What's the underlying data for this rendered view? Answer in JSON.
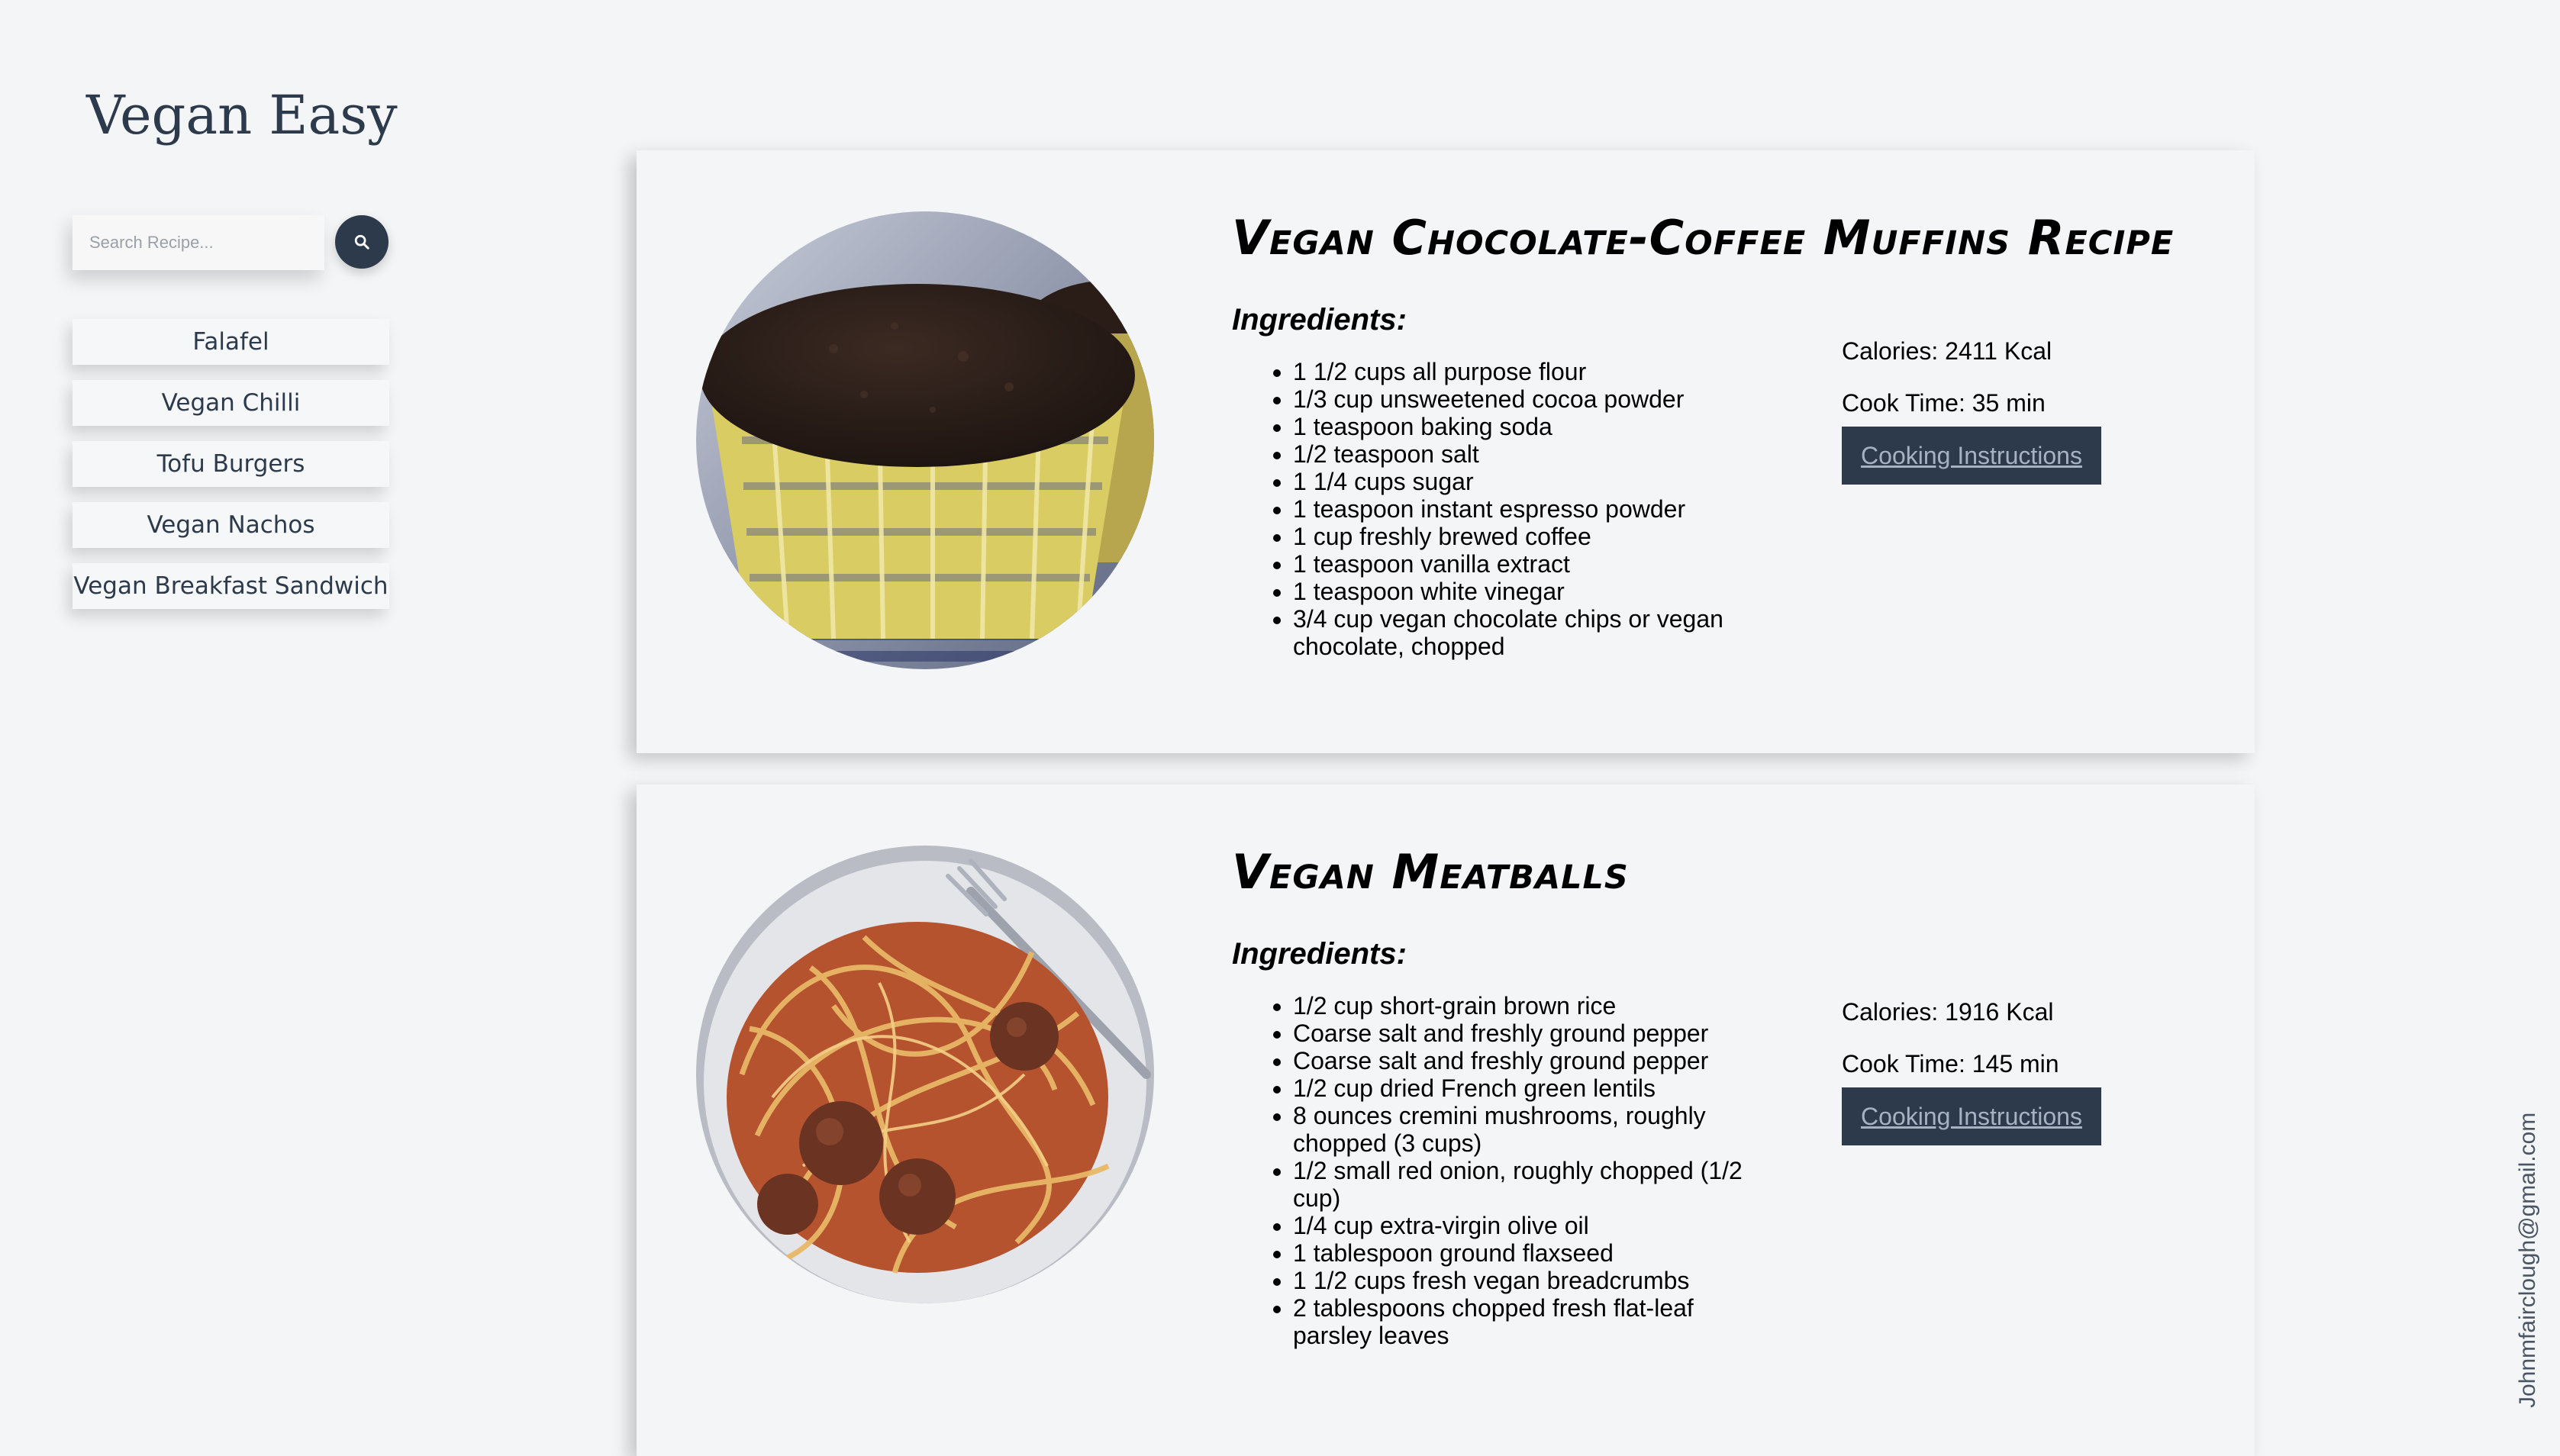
{
  "app": {
    "title": "Vegan Easy"
  },
  "search": {
    "placeholder": "Search Recipe...",
    "icon": "search-icon"
  },
  "nav": {
    "items": [
      {
        "label": "Falafel"
      },
      {
        "label": "Vegan Chilli"
      },
      {
        "label": "Tofu Burgers"
      },
      {
        "label": "Vegan Nachos"
      },
      {
        "label": "Vegan Breakfast Sandwich"
      }
    ]
  },
  "recipes": [
    {
      "title": "Vegan Chocolate-Coffee Muffins Recipe",
      "ingredients_heading": "Ingredients:",
      "image": "chocolate-muffin-photo",
      "ingredients": [
        "1 1/2 cups all purpose flour",
        "1/3 cup unsweetened cocoa powder",
        "1 teaspoon baking soda",
        "1/2 teaspoon salt",
        "1 1/4 cups sugar",
        "1 teaspoon instant espresso powder",
        "1 cup freshly brewed coffee",
        "1 teaspoon vanilla extract",
        "1 teaspoon white vinegar",
        "3/4 cup vegan chocolate chips or vegan chocolate, chopped"
      ],
      "calories": "Calories: 2411 Kcal",
      "cook_time": "Cook Time: 35 min",
      "instructions_label": "Cooking Instructions"
    },
    {
      "title": "Vegan Meatballs",
      "ingredients_heading": "Ingredients:",
      "image": "spaghetti-meatballs-photo",
      "ingredients": [
        "1/2 cup short-grain brown rice",
        "Coarse salt and freshly ground pepper",
        "Coarse salt and freshly ground pepper",
        "1/2 cup dried French green lentils",
        "8 ounces cremini mushrooms, roughly chopped (3 cups)",
        "1/2 small red onion, roughly chopped (1/2 cup)",
        "1/4 cup extra-virgin olive oil",
        "1 tablespoon ground flaxseed",
        "1 1/2 cups fresh vegan breadcrumbs",
        "2 tablespoons chopped fresh flat-leaf parsley leaves"
      ],
      "calories": "Calories: 1916 Kcal",
      "cook_time": "Cook Time: 145 min",
      "instructions_label": "Cooking Instructions"
    }
  ],
  "footer": {
    "email": "Johnmfairclough@gmail.com"
  },
  "colors": {
    "background": "#f4f5f7",
    "brand": "#2c3a4b",
    "button_text": "#a7b2c1"
  }
}
